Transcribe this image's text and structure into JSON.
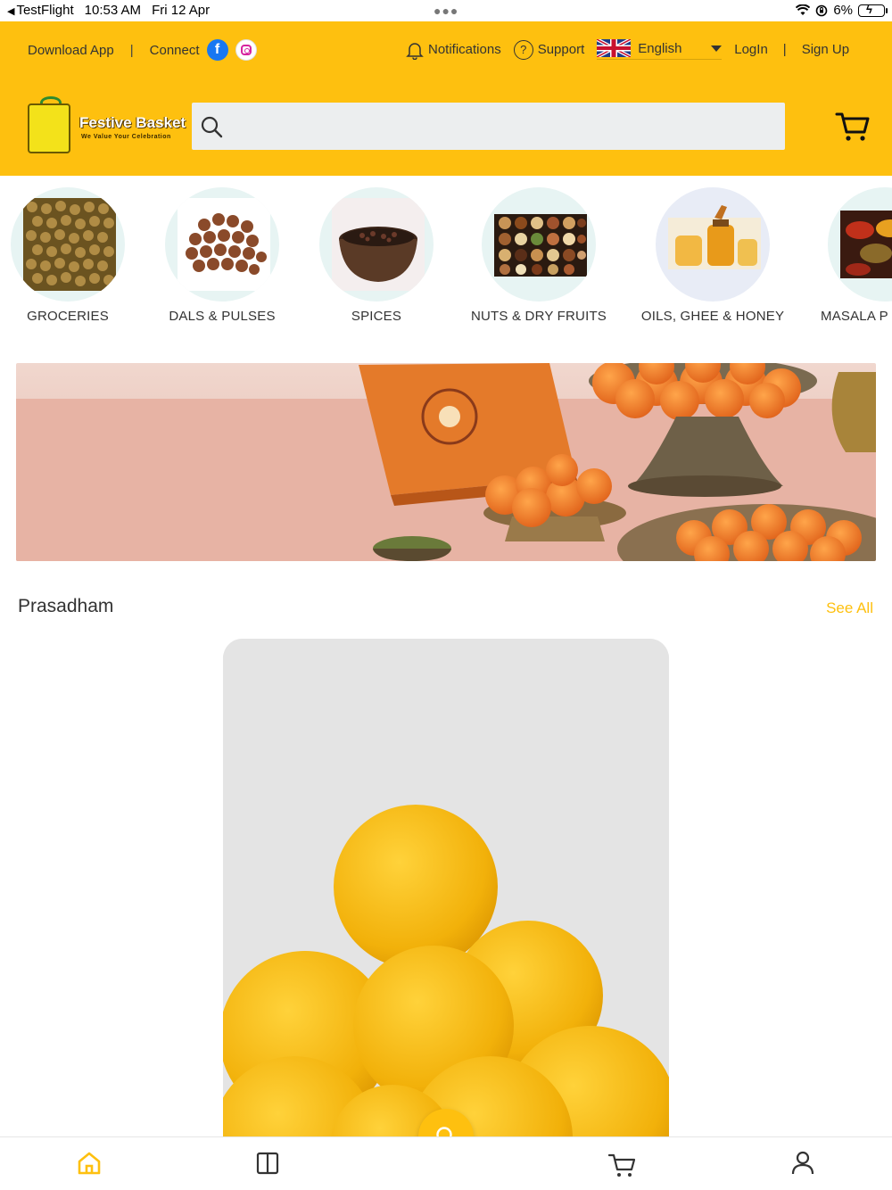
{
  "status_bar": {
    "app": "TestFlight",
    "time": "10:53 AM",
    "date": "Fri 12 Apr",
    "battery": "6%"
  },
  "header": {
    "download_app": "Download App",
    "connect": "Connect",
    "notifications": "Notifications",
    "support": "Support",
    "language": "English",
    "login": "LogIn",
    "signup": "Sign Up",
    "logo_title": "Festive Basket",
    "logo_tagline": "We Value Your Celebration",
    "search_placeholder": ""
  },
  "categories": [
    {
      "label": "GROCERIES"
    },
    {
      "label": "DALS & PULSES"
    },
    {
      "label": "SPICES"
    },
    {
      "label": "NUTS & DRY FRUITS"
    },
    {
      "label": "OILS, GHEE & HONEY"
    },
    {
      "label": "MASALA P"
    }
  ],
  "section": {
    "title": "Prasadham",
    "see_all": "See All"
  },
  "colors": {
    "brand_yellow": "#fec00f",
    "search_bg": "#eceeef"
  },
  "bottom_nav": [
    "home-icon",
    "categories-icon",
    "search-icon",
    "cart-icon",
    "profile-icon"
  ]
}
